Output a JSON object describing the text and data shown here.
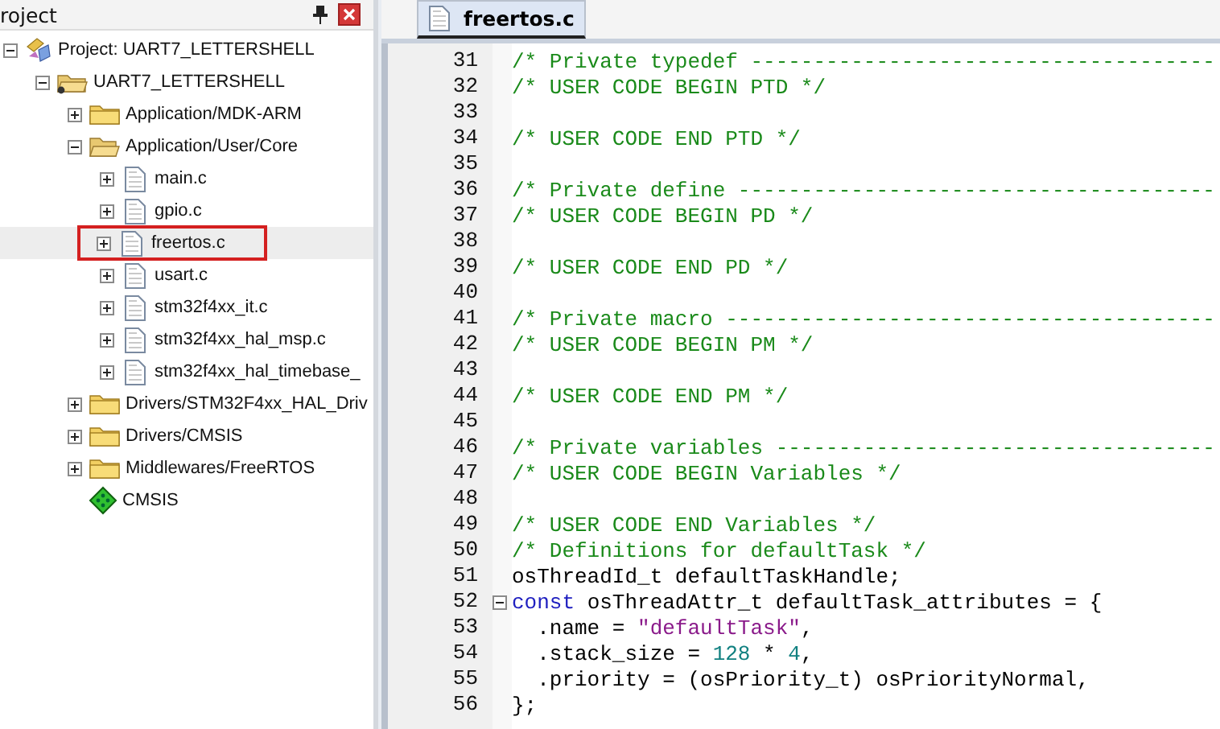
{
  "project_panel": {
    "title": "roject",
    "tree": [
      {
        "label": "Project: UART7_LETTERSHELL",
        "kind": "project",
        "expanded": true,
        "selected": false,
        "annotated": false,
        "children": [
          {
            "label": "UART7_LETTERSHELL",
            "kind": "target",
            "expanded": true,
            "selected": false,
            "annotated": false,
            "children": [
              {
                "label": "Application/MDK-ARM",
                "kind": "folder",
                "expanded": false,
                "selected": false,
                "annotated": false
              },
              {
                "label": "Application/User/Core",
                "kind": "folder",
                "expanded": true,
                "selected": false,
                "annotated": false,
                "children": [
                  {
                    "label": "main.c",
                    "kind": "file",
                    "expanded": false,
                    "selected": false,
                    "annotated": false
                  },
                  {
                    "label": "gpio.c",
                    "kind": "file",
                    "expanded": false,
                    "selected": false,
                    "annotated": false
                  },
                  {
                    "label": "freertos.c",
                    "kind": "file",
                    "expanded": false,
                    "selected": true,
                    "annotated": true
                  },
                  {
                    "label": "usart.c",
                    "kind": "file",
                    "expanded": false,
                    "selected": false,
                    "annotated": false
                  },
                  {
                    "label": "stm32f4xx_it.c",
                    "kind": "file",
                    "expanded": false,
                    "selected": false,
                    "annotated": false
                  },
                  {
                    "label": "stm32f4xx_hal_msp.c",
                    "kind": "file",
                    "expanded": false,
                    "selected": false,
                    "annotated": false
                  },
                  {
                    "label": "stm32f4xx_hal_timebase_",
                    "kind": "file",
                    "expanded": false,
                    "selected": false,
                    "annotated": false
                  }
                ]
              },
              {
                "label": "Drivers/STM32F4xx_HAL_Driv",
                "kind": "folder",
                "expanded": false,
                "selected": false,
                "annotated": false
              },
              {
                "label": "Drivers/CMSIS",
                "kind": "folder",
                "expanded": false,
                "selected": false,
                "annotated": false
              },
              {
                "label": "Middlewares/FreeRTOS",
                "kind": "folder",
                "expanded": false,
                "selected": false,
                "annotated": false
              },
              {
                "label": "CMSIS",
                "kind": "component",
                "selected": false,
                "annotated": false
              }
            ]
          }
        ]
      }
    ]
  },
  "editor": {
    "tabs": [
      {
        "label": "freertos.c",
        "selected": true
      }
    ],
    "lines": [
      {
        "number": "31",
        "code": [
          {
            "kind": "comment",
            "text": "/* Private typedef -------------------------------------"
          }
        ]
      },
      {
        "number": "32",
        "code": [
          {
            "kind": "comment",
            "text": "/* USER CODE BEGIN PTD */"
          }
        ]
      },
      {
        "number": "33"
      },
      {
        "number": "34",
        "code": [
          {
            "kind": "comment",
            "text": "/* USER CODE END PTD */"
          }
        ]
      },
      {
        "number": "35"
      },
      {
        "number": "36",
        "code": [
          {
            "kind": "comment",
            "text": "/* Private define --------------------------------------"
          }
        ]
      },
      {
        "number": "37",
        "code": [
          {
            "kind": "comment",
            "text": "/* USER CODE BEGIN PD */"
          }
        ]
      },
      {
        "number": "38"
      },
      {
        "number": "39",
        "code": [
          {
            "kind": "comment",
            "text": "/* USER CODE END PD */"
          }
        ]
      },
      {
        "number": "40"
      },
      {
        "number": "41",
        "code": [
          {
            "kind": "comment",
            "text": "/* Private macro ---------------------------------------"
          }
        ]
      },
      {
        "number": "42",
        "code": [
          {
            "kind": "comment",
            "text": "/* USER CODE BEGIN PM */"
          }
        ]
      },
      {
        "number": "43"
      },
      {
        "number": "44",
        "code": [
          {
            "kind": "comment",
            "text": "/* USER CODE END PM */"
          }
        ]
      },
      {
        "number": "45"
      },
      {
        "number": "46",
        "code": [
          {
            "kind": "comment",
            "text": "/* Private variables -----------------------------------"
          }
        ]
      },
      {
        "number": "47",
        "code": [
          {
            "kind": "comment",
            "text": "/* USER CODE BEGIN Variables */"
          }
        ]
      },
      {
        "number": "48"
      },
      {
        "number": "49",
        "code": [
          {
            "kind": "comment",
            "text": "/* USER CODE END Variables */"
          }
        ]
      },
      {
        "number": "50",
        "code": [
          {
            "kind": "comment",
            "text": "/* Definitions for defaultTask */"
          }
        ]
      },
      {
        "number": "51",
        "code": [
          {
            "kind": "plain",
            "text": "osThreadId_t defaultTaskHandle;"
          }
        ]
      },
      {
        "number": "52",
        "fold": true,
        "code": [
          {
            "kind": "keyword",
            "text": "const"
          },
          {
            "kind": "plain",
            "text": " osThreadAttr_t defaultTask_attributes = {"
          }
        ]
      },
      {
        "number": "53",
        "code": [
          {
            "kind": "plain",
            "text": "  .name = "
          },
          {
            "kind": "string",
            "text": "\"defaultTask\""
          },
          {
            "kind": "plain",
            "text": ","
          }
        ]
      },
      {
        "number": "54",
        "code": [
          {
            "kind": "plain",
            "text": "  .stack_size = "
          },
          {
            "kind": "number",
            "text": "128"
          },
          {
            "kind": "plain",
            "text": " * "
          },
          {
            "kind": "number",
            "text": "4"
          },
          {
            "kind": "plain",
            "text": ","
          }
        ]
      },
      {
        "number": "55",
        "code": [
          {
            "kind": "plain",
            "text": "  .priority = (osPriority_t) osPriorityNormal,"
          }
        ]
      },
      {
        "number": "56",
        "code": [
          {
            "kind": "plain",
            "text": "};"
          }
        ]
      }
    ]
  }
}
